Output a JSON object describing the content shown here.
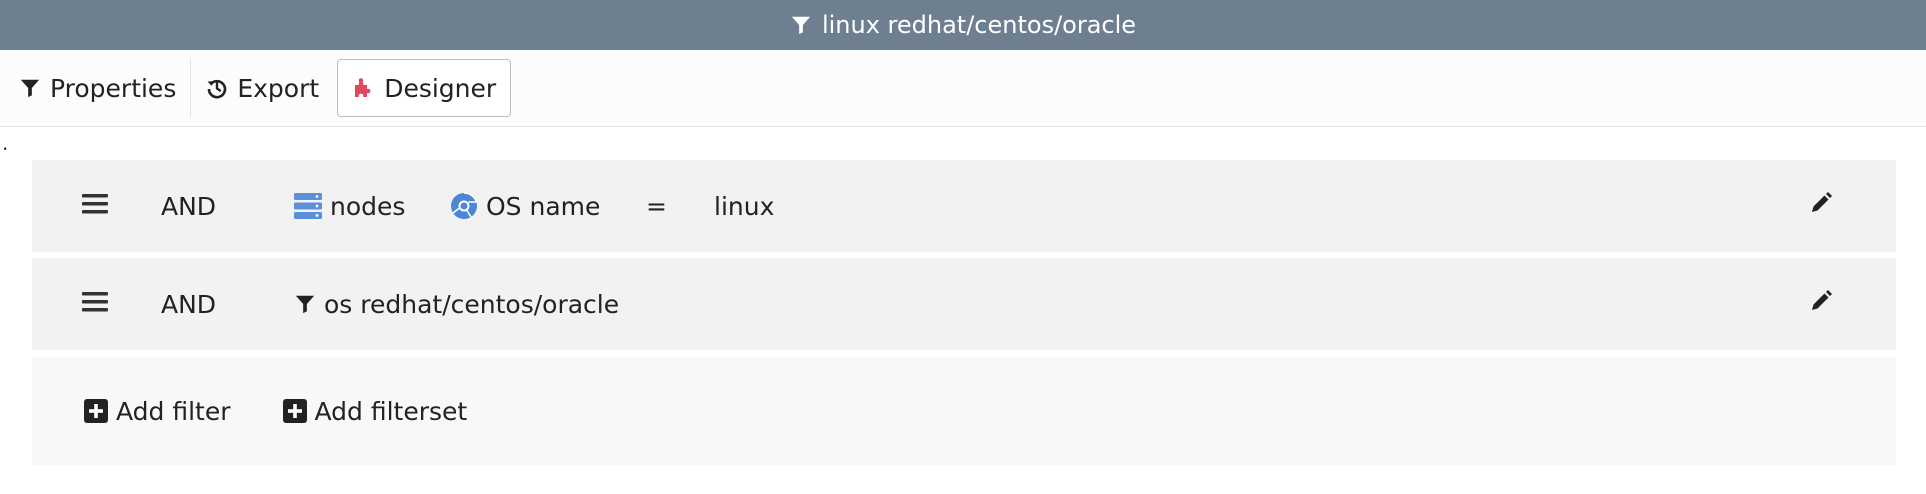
{
  "window": {
    "title": "linux redhat/centos/oracle"
  },
  "tabs": [
    {
      "label": "Properties"
    },
    {
      "label": "Export"
    },
    {
      "label": "Designer"
    }
  ],
  "stray_text": ".",
  "rows": [
    {
      "operator": "AND",
      "entity": "nodes",
      "field": "OS name",
      "comparator": "=",
      "value": "linux"
    },
    {
      "operator": "AND",
      "filterset": "os redhat/centos/oracle"
    }
  ],
  "footer": {
    "add_filter": "Add filter",
    "add_filterset": "Add filterset"
  },
  "colors": {
    "titlebar": "#6e7f8f",
    "row_bg": "#f2f2f2",
    "footer_bg": "#f8f8f8",
    "nodes_icon": "#5b8fd9",
    "os_icon": "#4e86d6",
    "designer_icon": "#e0485f"
  }
}
